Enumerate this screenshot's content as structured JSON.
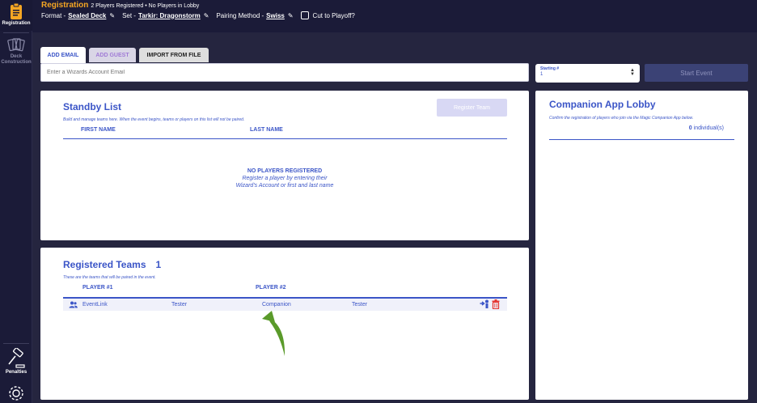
{
  "sidebar": {
    "registration": "Registration",
    "deck_line1": "Deck",
    "deck_line2": "Construction",
    "penalties": "Penalties"
  },
  "header": {
    "title": "Registration",
    "summary": "2 Players Registered • No Players in Lobby",
    "format_label": "Format -",
    "format_value": "Sealed Deck",
    "set_label": "Set -",
    "set_value": "Tarkir: Dragonstorm",
    "pairing_label": "Pairing Method -",
    "pairing_value": "Swiss",
    "cut_label": "Cut to Playoff?"
  },
  "tabs": {
    "add_email": "ADD EMAIL",
    "add_guest": "ADD GUEST",
    "import": "IMPORT FROM FILE"
  },
  "email_input": {
    "placeholder": "Enter a Wizards Account Email"
  },
  "starting": {
    "label": "Starting #",
    "value": "1"
  },
  "start_event": "Start Event",
  "standby": {
    "title": "Standby List",
    "desc": "Build and manage teams here. When the event begins, teams or players on this list will not be paired.",
    "register_btn": "Register Team",
    "col1": "FIRST NAME",
    "col2": "LAST NAME",
    "empty_title": "NO PLAYERS REGISTERED",
    "empty_line1": "Register a player by entering their",
    "empty_line2": "Wizard's Account or first and last name"
  },
  "teams": {
    "title": "Registered Teams",
    "count": "1",
    "desc": "These are the teams that will be paired in the event.",
    "col1": "PLAYER #1",
    "col2": "PLAYER #2",
    "rows": [
      {
        "p1_first": "EventLink",
        "p1_last": "Tester",
        "p2_first": "Companion",
        "p2_last": "Tester"
      }
    ]
  },
  "companion": {
    "title": "Companion App Lobby",
    "desc": "Confirm the registration of players who join via the Magic Companion App below.",
    "count": "0",
    "count_label": "individual(s)"
  },
  "colors": {
    "accent": "#3b55c7",
    "orange": "#f5a623",
    "nav": "#1b1b38",
    "arrow": "#5a9a2a",
    "delete": "#e53935"
  }
}
